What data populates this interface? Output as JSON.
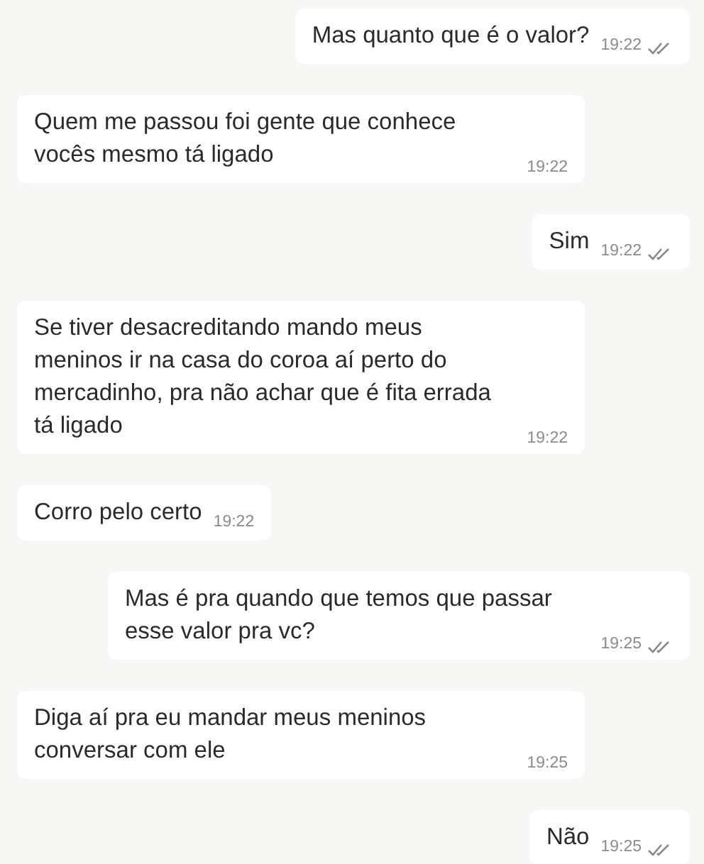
{
  "messages": [
    {
      "kind": "out",
      "text": "Mas quanto que é o valor?",
      "time": "19:22"
    },
    {
      "kind": "in",
      "text": "Quem me passou foi gente que conhece vocês mesmo tá ligado",
      "time": "19:22"
    },
    {
      "kind": "out",
      "text": "Sim",
      "time": "19:22"
    },
    {
      "kind": "in",
      "text": "Se tiver desacreditando mando meus meninos ir na casa do coroa aí perto do mercadinho, pra não achar que é fita errada tá ligado",
      "time": "19:22"
    },
    {
      "kind": "in",
      "text": "Corro pelo certo",
      "time": "19:22"
    },
    {
      "kind": "out",
      "text": "Mas é pra quando que temos que passar esse valor pra vc?",
      "time": "19:25"
    },
    {
      "kind": "in",
      "text": "Diga aí pra eu mandar meus meninos conversar com ele",
      "time": "19:25"
    },
    {
      "kind": "out",
      "text": "Não",
      "time": "19:25"
    }
  ]
}
